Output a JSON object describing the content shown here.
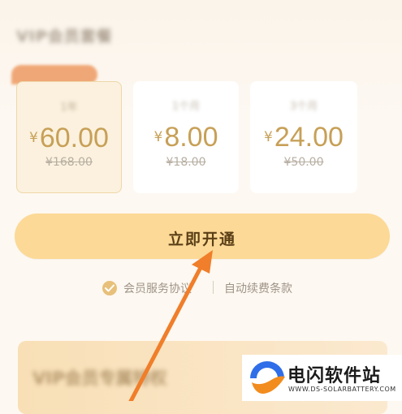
{
  "section": {
    "title": "VIP会员套餐"
  },
  "plans": [
    {
      "name": "1年",
      "price": "60.00",
      "original": "¥168.00",
      "currency": "¥"
    },
    {
      "name": "1个月",
      "price": "8.00",
      "original": "¥18.00",
      "currency": "¥"
    },
    {
      "name": "3个月",
      "price": "24.00",
      "original": "¥50.00",
      "currency": "¥"
    }
  ],
  "cta": {
    "label": "立即开通"
  },
  "agreement": {
    "service": "会员服务协议",
    "renewal": "自动续费条款",
    "checked": true
  },
  "banner": {
    "title": "VIP会员专属特权"
  },
  "watermark": {
    "name": "电闪软件站",
    "url": "WWW.DS-SOLARBATTERY.COM"
  },
  "colors": {
    "accent": "#fcd996",
    "price": "#c7a057",
    "arrow": "#f07e2a"
  }
}
